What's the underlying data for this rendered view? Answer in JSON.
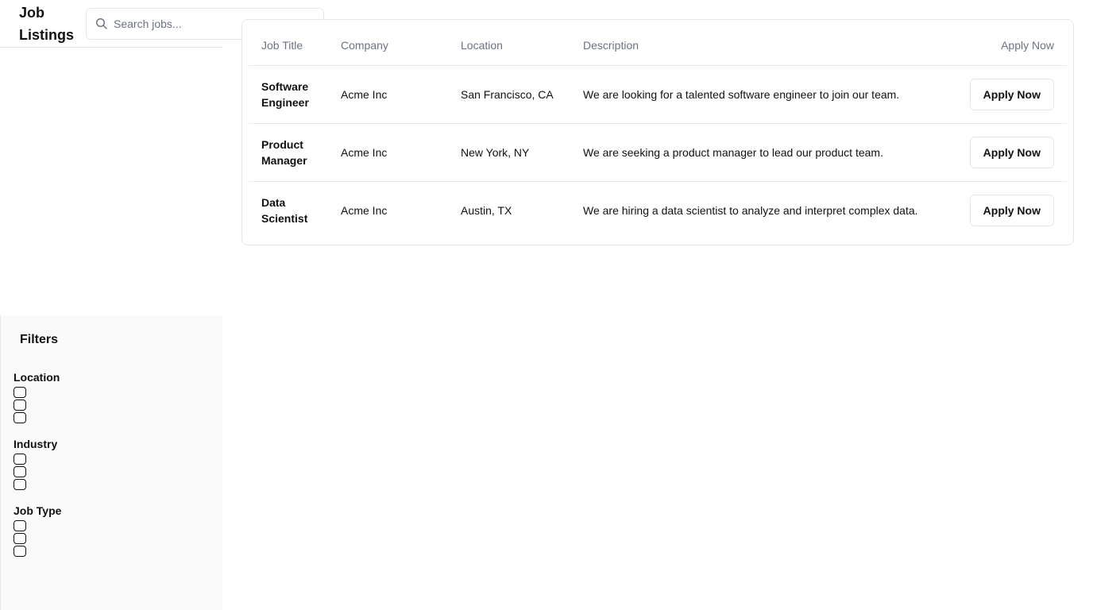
{
  "header": {
    "title": "Job Listings",
    "search_placeholder": "Search jobs..."
  },
  "table": {
    "headers": [
      "Job Title",
      "Company",
      "Location",
      "Description",
      "Apply Now"
    ],
    "rows": [
      {
        "title": "Software Engineer",
        "company": "Acme Inc",
        "location": "San Francisco, CA",
        "description": "We are looking for a talented software engineer to join our team.",
        "button": "Apply Now"
      },
      {
        "title": "Product Manager",
        "company": "Acme Inc",
        "location": "New York, NY",
        "description": "We are seeking a product manager to lead our product team.",
        "button": "Apply Now"
      },
      {
        "title": "Data Scientist",
        "company": "Acme Inc",
        "location": "Austin, TX",
        "description": "We are hiring a data scientist to analyze and interpret complex data.",
        "button": "Apply Now"
      }
    ]
  },
  "filters": {
    "title": "Filters",
    "groups": [
      {
        "label": "Location"
      },
      {
        "label": "Industry"
      },
      {
        "label": "Job Type"
      }
    ]
  },
  "icons": {
    "search": "search-icon"
  },
  "colors": {
    "border": "#e5e7eb",
    "muted_text": "#6b7280",
    "sidebar_bg": "#f9faf9"
  }
}
